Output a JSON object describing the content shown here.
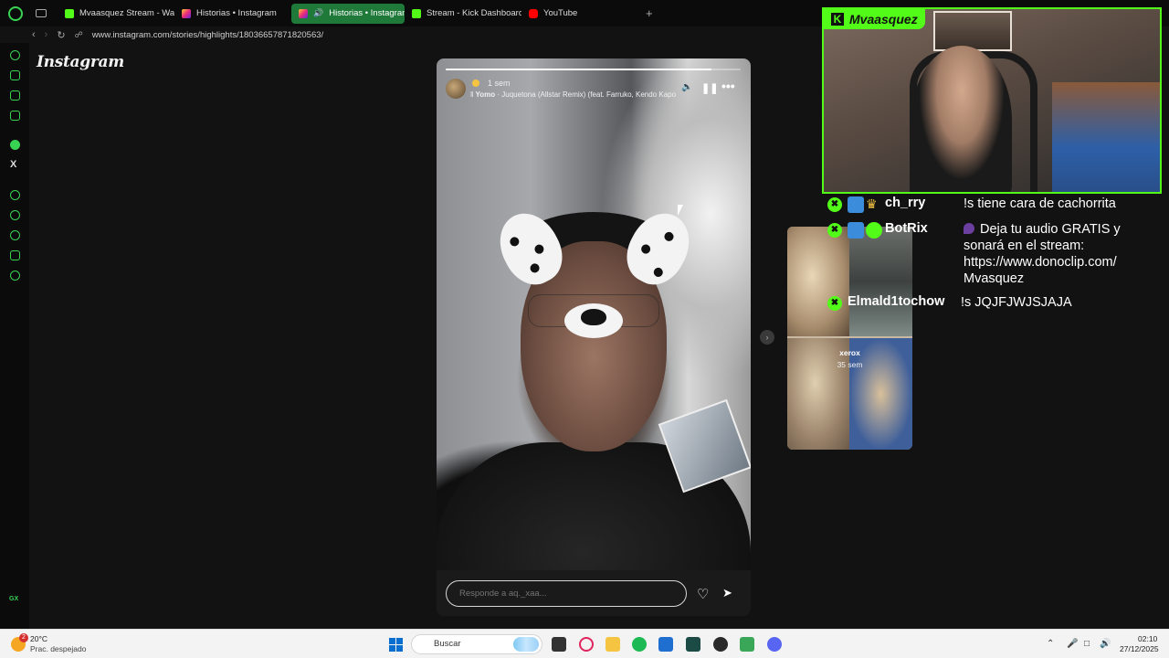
{
  "browser": {
    "tabs": [
      {
        "label": "Mvaasquez Stream - Wal",
        "icon": "kick-icon"
      },
      {
        "label": "Historias • Instagram",
        "icon": "instagram-icon"
      },
      {
        "label": "Historias • Instagram",
        "icon": "instagram-icon",
        "active": true,
        "audio": true
      },
      {
        "label": "Stream - Kick Dashboard",
        "icon": "kick-icon"
      },
      {
        "label": "YouTube",
        "icon": "youtube-icon"
      }
    ],
    "url": "www.instagram.com/stories/highlights/18036657871820563/",
    "accent": "#39d353"
  },
  "instagram": {
    "logo": "Instagram",
    "story": {
      "time": "1 sem",
      "music_artist": "Yomo",
      "music_track": " · Juquetona (Allstar Remix) (feat. Farruko, Kendo Kapo",
      "reply_placeholder": "Responde a aq._xaa...",
      "progress": 0.9
    },
    "next_story": {
      "user": "xerox",
      "time": "35 sem"
    }
  },
  "overlay": {
    "streamer_name": "Mvaasquez",
    "kick_color": "#53fc18",
    "chat": [
      {
        "user": "ch_rry",
        "text": "!s tiene cara de cachorrita"
      },
      {
        "user": "BotRix",
        "text": "Deja tu audio GRATIS y sonará en el stream: https://www.donoclip.com/ Mvasquez"
      },
      {
        "user": "Elmald1tochow",
        "text": "!s JQJFJWJSJAJA"
      }
    ]
  },
  "taskbar": {
    "weather_temp": "20°C",
    "weather_desc": "Prac. despejado",
    "weather_badge": "2",
    "search_label": "Buscar",
    "time": "02:10",
    "date": "27/12/2025"
  },
  "sidebar": {
    "gx_label": "GX"
  }
}
